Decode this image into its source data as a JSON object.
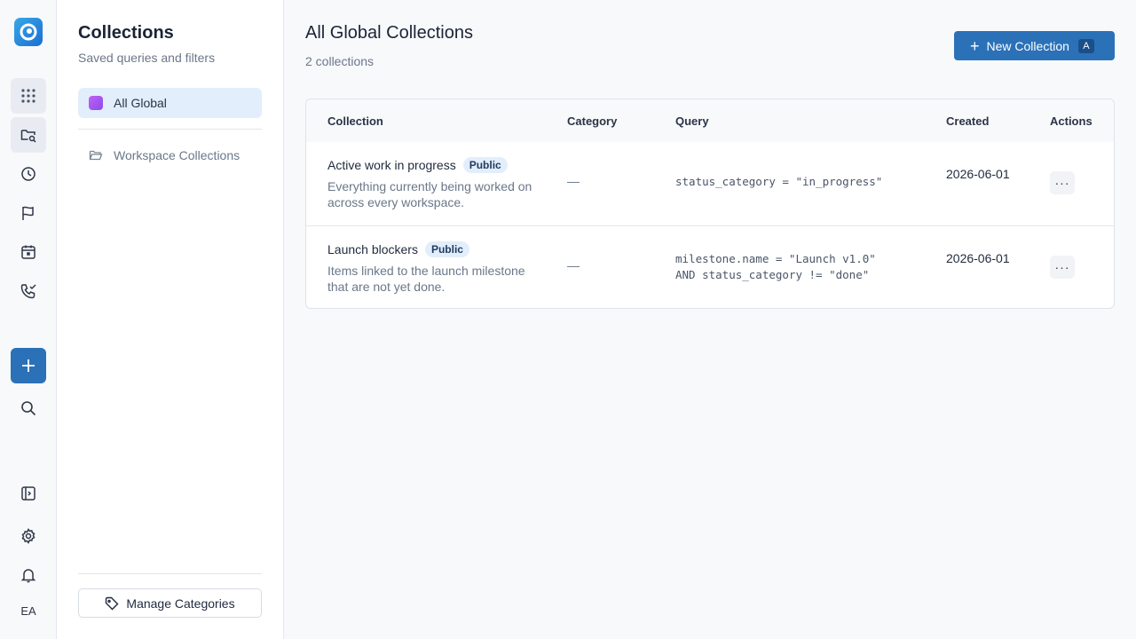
{
  "rail": {
    "icons": [
      "grid-icon",
      "folder-search-icon",
      "clock-icon",
      "flag-icon",
      "calendar-icon",
      "phone-check-icon",
      "plus-icon",
      "search-icon",
      "sidebar-toggle-icon",
      "gear-icon",
      "bell-icon"
    ],
    "avatar": "EA"
  },
  "panel": {
    "title": "Collections",
    "subtitle": "Saved queries and filters",
    "items": [
      {
        "label": "All Global"
      },
      {
        "label": "Workspace Collections"
      }
    ],
    "manage_label": "Manage Categories"
  },
  "main": {
    "title": "All Global Collections",
    "count": "2 collections",
    "new_button": {
      "label": "New Collection",
      "shortcut": "A"
    },
    "table": {
      "headers": [
        "Collection",
        "Category",
        "Query",
        "Created",
        "Actions"
      ],
      "rows": [
        {
          "name": "Active work in progress",
          "badge": "Public",
          "description": "Everything currently being worked on across every workspace.",
          "category": "—",
          "query": "status_category = \"in_progress\"",
          "created": "2026-06-01",
          "actions": "···"
        },
        {
          "name": "Launch blockers",
          "badge": "Public",
          "description": "Items linked to the launch milestone that are not yet done.",
          "category": "—",
          "query": "milestone.name = \"Launch v1.0\"\nAND status_category != \"done\"",
          "created": "2026-06-01",
          "actions": "···"
        }
      ]
    }
  },
  "colors": {
    "accent": "#2b71b8",
    "badge_bg": "#e2eefb"
  }
}
